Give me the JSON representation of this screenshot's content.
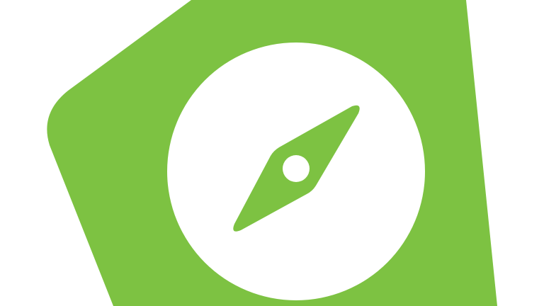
{
  "colors": {
    "background": "#ffffff",
    "brand_green": "#7dc242",
    "compass_face": "#ffffff",
    "needle": "#7dc242",
    "needle_pivot": "#ffffff"
  },
  "icon": {
    "name": "compass-app-icon",
    "parts": [
      "green-pentagon-badge",
      "white-compass-face",
      "compass-needle",
      "needle-pivot-dot"
    ]
  }
}
